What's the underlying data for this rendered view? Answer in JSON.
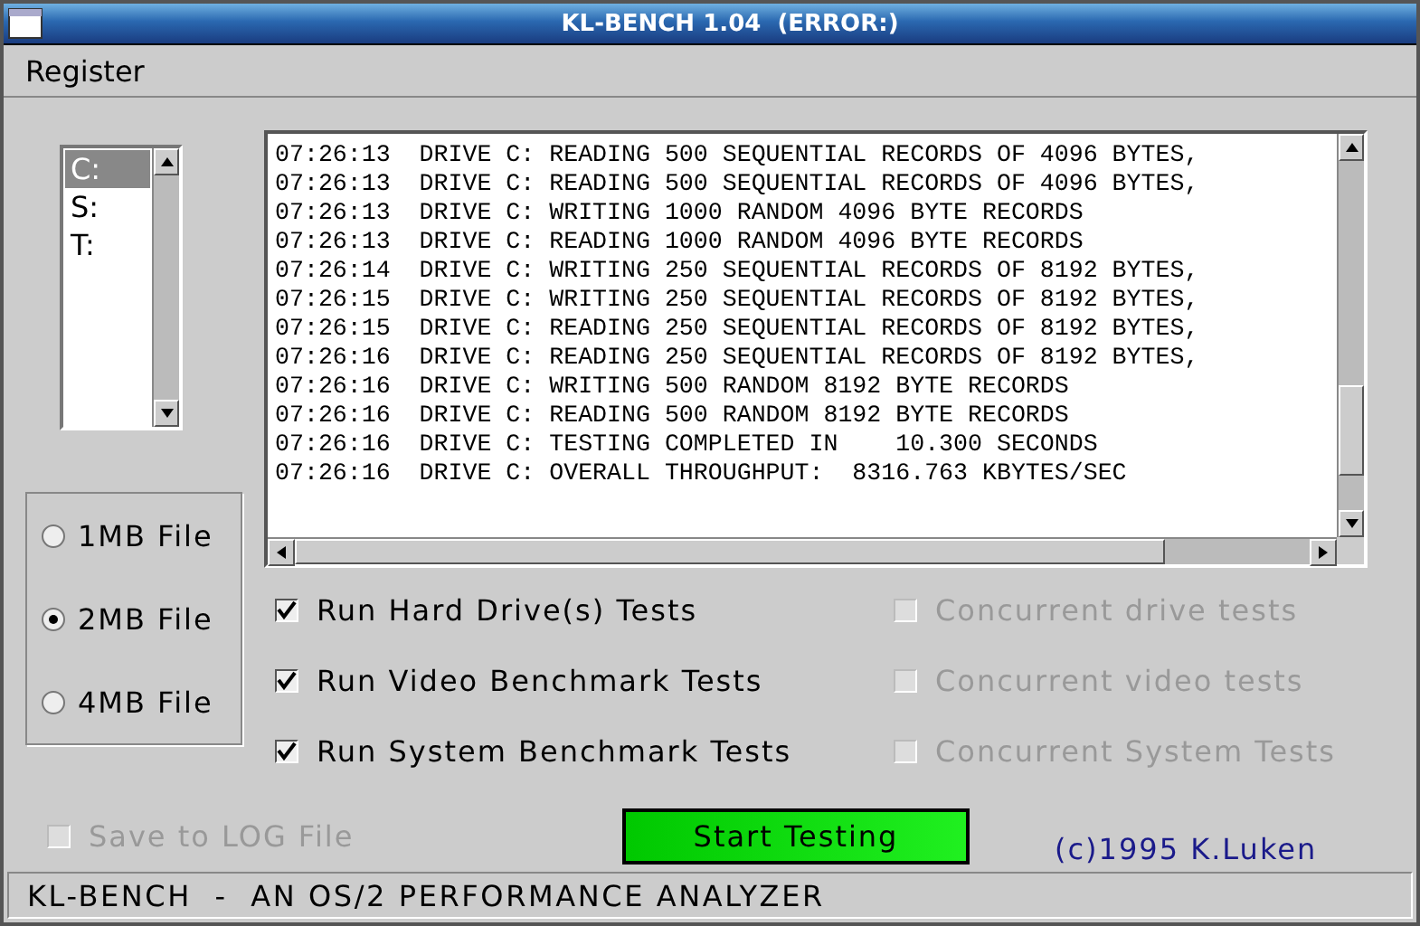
{
  "window": {
    "title": "KL-BENCH 1.04  (ERROR:)"
  },
  "menu": [
    "Register"
  ],
  "drives": [
    {
      "label": "C:",
      "selected": true
    },
    {
      "label": "S:",
      "selected": false
    },
    {
      "label": "T:",
      "selected": false
    }
  ],
  "file_sizes": [
    {
      "label": "1MB File",
      "selected": false
    },
    {
      "label": "2MB File",
      "selected": true
    },
    {
      "label": "4MB File",
      "selected": false
    }
  ],
  "log": [
    "07:26:13  DRIVE C: READING 500 SEQUENTIAL RECORDS OF 4096 BYTES,",
    "07:26:13  DRIVE C: READING 500 SEQUENTIAL RECORDS OF 4096 BYTES,",
    "07:26:13  DRIVE C: WRITING 1000 RANDOM 4096 BYTE RECORDS",
    "07:26:13  DRIVE C: READING 1000 RANDOM 4096 BYTE RECORDS",
    "07:26:14  DRIVE C: WRITING 250 SEQUENTIAL RECORDS OF 8192 BYTES,",
    "07:26:15  DRIVE C: WRITING 250 SEQUENTIAL RECORDS OF 8192 BYTES,",
    "07:26:15  DRIVE C: READING 250 SEQUENTIAL RECORDS OF 8192 BYTES,",
    "07:26:16  DRIVE C: READING 250 SEQUENTIAL RECORDS OF 8192 BYTES,",
    "07:26:16  DRIVE C: WRITING 500 RANDOM 8192 BYTE RECORDS",
    "07:26:16  DRIVE C: READING 500 RANDOM 8192 BYTE RECORDS",
    "07:26:16  DRIVE C: TESTING COMPLETED IN    10.300 SECONDS",
    "07:26:16  DRIVE C: OVERALL THROUGHPUT:  8316.763 KBYTES/SEC"
  ],
  "options": [
    {
      "label": "Run Hard Drive(s) Tests",
      "checked": true,
      "disabled": false
    },
    {
      "label": "Concurrent drive tests",
      "checked": false,
      "disabled": true
    },
    {
      "label": "Run Video Benchmark Tests",
      "checked": true,
      "disabled": false
    },
    {
      "label": "Concurrent video tests",
      "checked": false,
      "disabled": true
    },
    {
      "label": "Run System Benchmark Tests",
      "checked": true,
      "disabled": false
    },
    {
      "label": "Concurrent System Tests",
      "checked": false,
      "disabled": true
    }
  ],
  "save_log": {
    "label": "Save to LOG File",
    "checked": false,
    "disabled": true
  },
  "start_button": "Start Testing",
  "copyright": "(c)1995 K.Luken",
  "status_bar": "KL-BENCH  -  AN OS/2 PERFORMANCE ANALYZER"
}
